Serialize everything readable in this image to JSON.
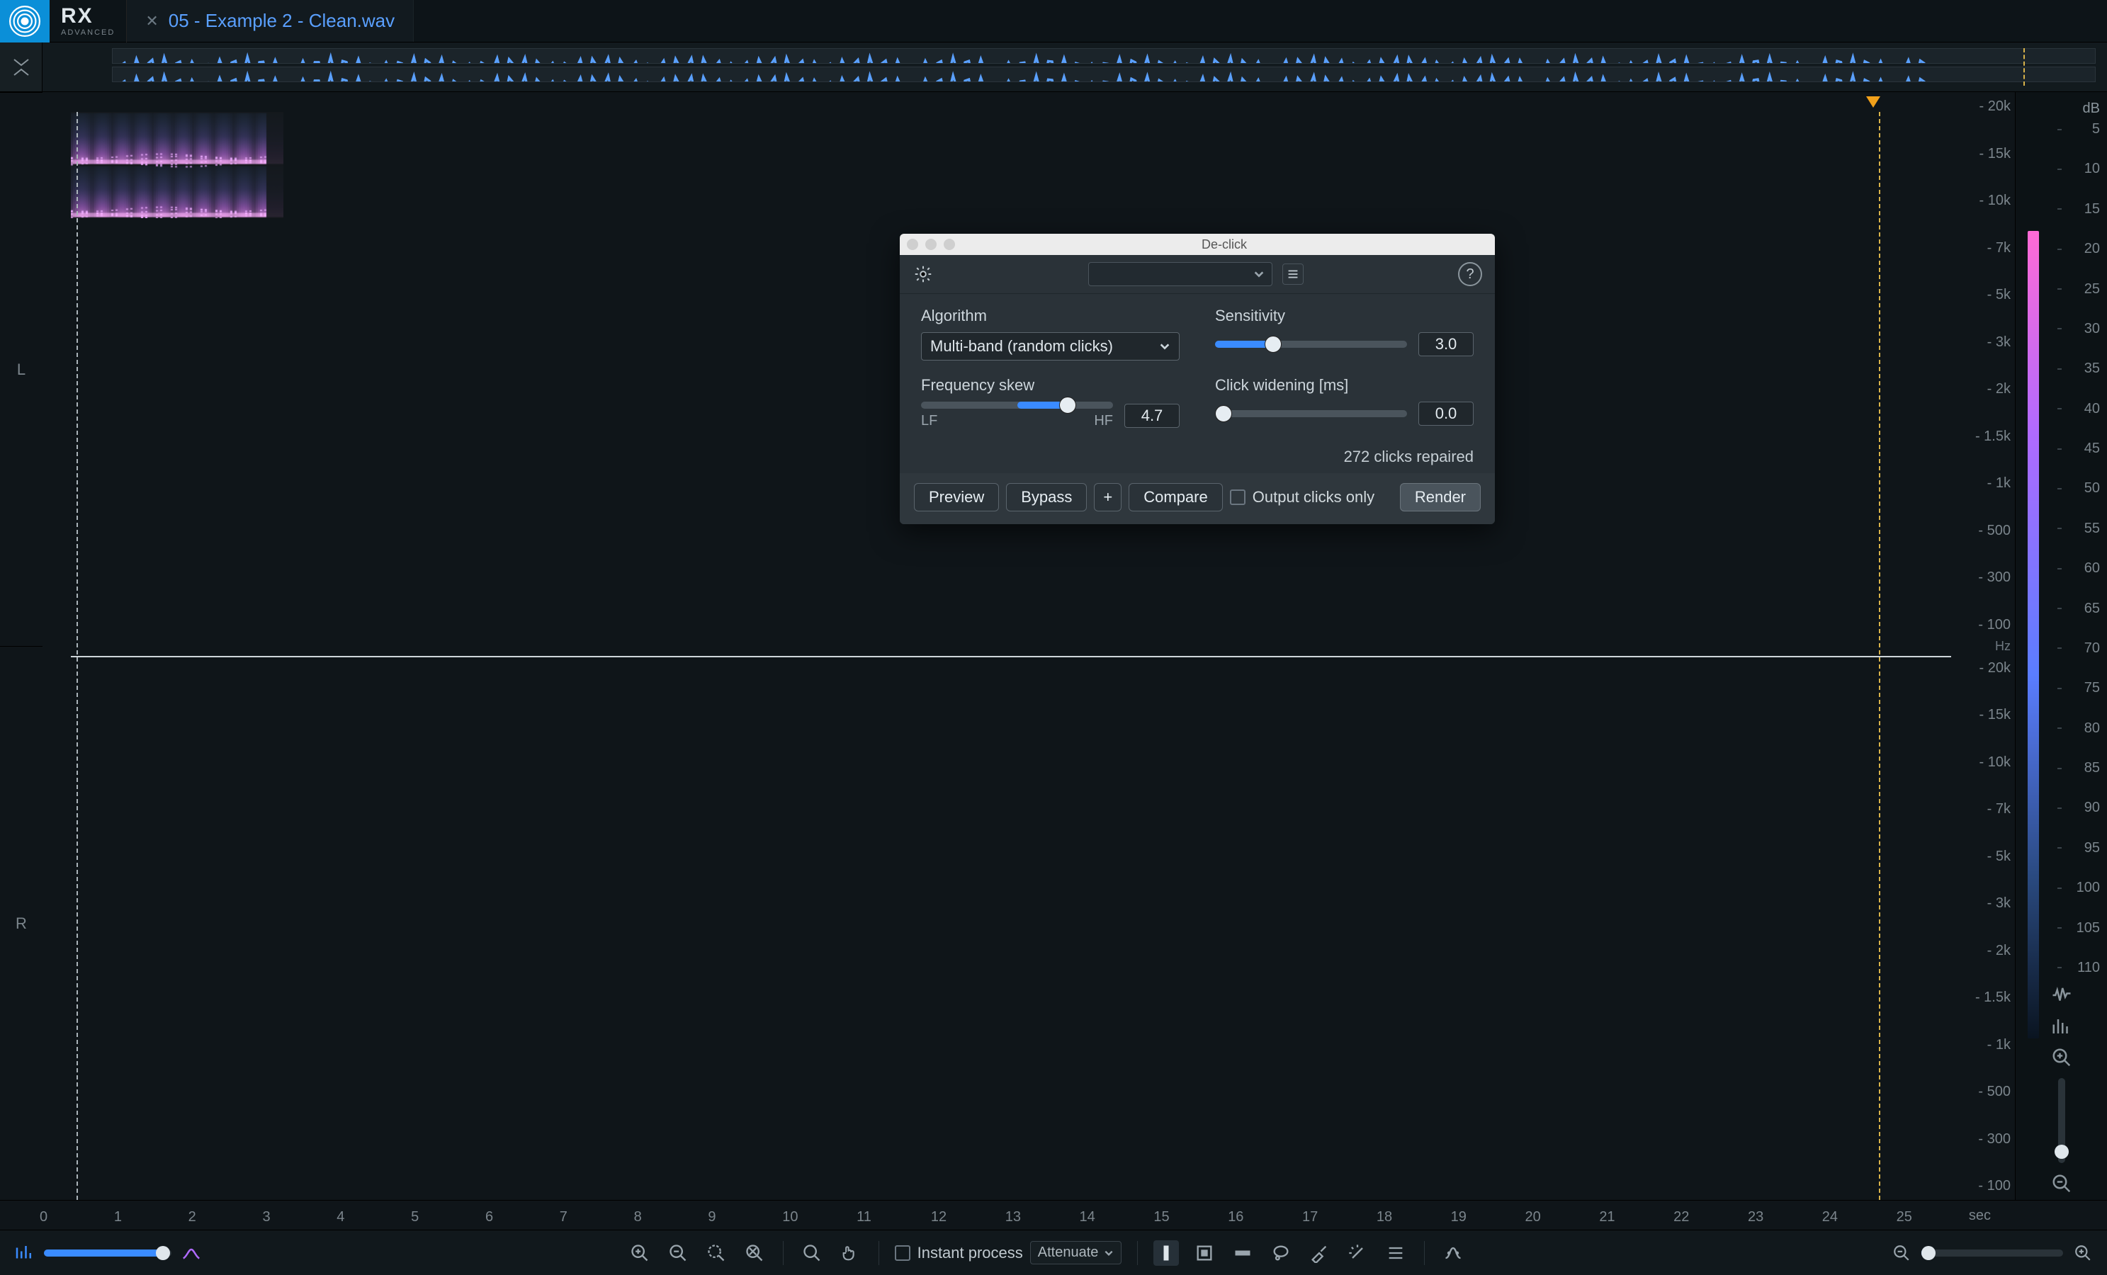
{
  "app": {
    "name": "RX",
    "edition": "ADVANCED"
  },
  "tab": {
    "filename": "05 - Example 2 - Clean.wav"
  },
  "channels": {
    "left": "L",
    "right": "R"
  },
  "freq_ticks": [
    "20k",
    "15k",
    "10k",
    "7k",
    "5k",
    "3k",
    "2k",
    "1.5k",
    "1k",
    "500",
    "300",
    "100"
  ],
  "freq_unit": "Hz",
  "db": {
    "title": "dB",
    "ticks": [
      "5",
      "10",
      "15",
      "20",
      "25",
      "30",
      "35",
      "40",
      "45",
      "50",
      "55",
      "60",
      "65",
      "70",
      "75",
      "80",
      "85",
      "90",
      "95",
      "100",
      "105",
      "110"
    ]
  },
  "overview": {
    "waveform_color": "#5aa0ff"
  },
  "time": {
    "ticks": [
      "0",
      "1",
      "2",
      "3",
      "4",
      "5",
      "6",
      "7",
      "8",
      "9",
      "10",
      "11",
      "12",
      "13",
      "14",
      "15",
      "16",
      "17",
      "18",
      "19",
      "20",
      "21",
      "22",
      "23",
      "24",
      "25"
    ],
    "unit": "sec"
  },
  "toolbar": {
    "instant_process_label": "Instant process",
    "instant_mode": "Attenuate",
    "icons_left": "waveform-opacity-icon",
    "spectrogram_opacity_icon": "spectrogram-opacity-icon"
  },
  "dialog": {
    "title": "De-click",
    "algorithm_label": "Algorithm",
    "algorithm_value": "Multi-band (random clicks)",
    "sensitivity_label": "Sensitivity",
    "sensitivity_value": "3.0",
    "freq_skew_label": "Frequency skew",
    "freq_skew_value": "4.7",
    "freq_skew_lf": "LF",
    "freq_skew_hf": "HF",
    "click_widen_label": "Click widening [ms]",
    "click_widen_value": "0.0",
    "status": "272 clicks repaired",
    "preview": "Preview",
    "bypass": "Bypass",
    "plus": "+",
    "compare": "Compare",
    "output_clicks_only": "Output clicks only",
    "render": "Render"
  }
}
